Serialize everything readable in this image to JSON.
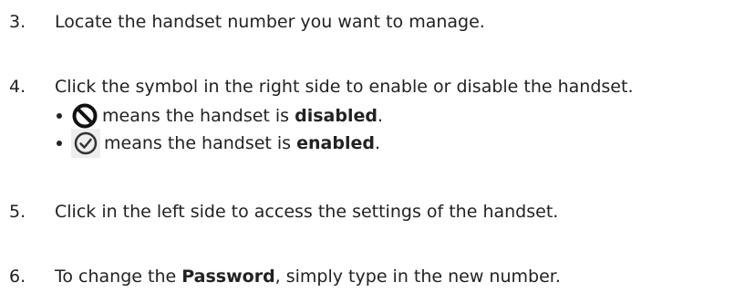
{
  "steps": [
    {
      "number": "3.",
      "text": "Locate the handset number you want to manage."
    },
    {
      "number": "4.",
      "text": "Click the symbol in the right side to enable or disable the handset."
    },
    {
      "number": "5.",
      "text": "Click in the left side to access the settings of the handset."
    },
    {
      "number": "6.",
      "text_before": "To change the ",
      "text_bold": "Password",
      "text_after": ", simply type in the new number."
    }
  ],
  "bullets": [
    {
      "icon": "disabled-icon",
      "text_before": "means the handset is ",
      "text_bold": "disabled",
      "text_after": "."
    },
    {
      "icon": "enabled-icon",
      "text_before": "means the handset is ",
      "text_bold": "enabled",
      "text_after": "."
    }
  ]
}
